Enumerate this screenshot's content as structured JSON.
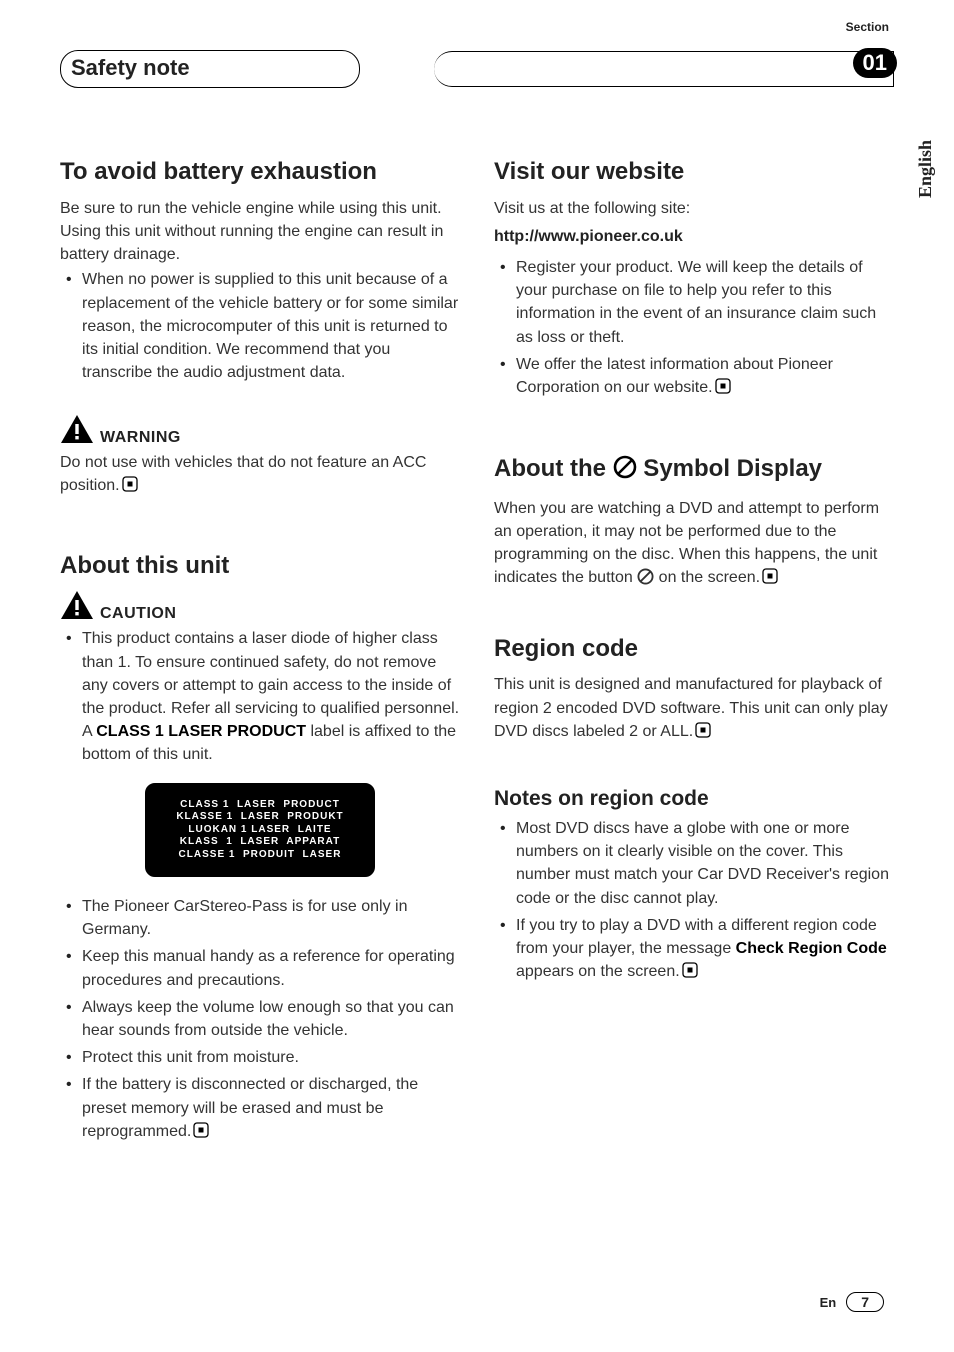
{
  "header": {
    "safety_title": "Safety note",
    "section_label": "Section",
    "section_number": "01",
    "language_tab": "English"
  },
  "left": {
    "h_battery": "To avoid battery exhaustion",
    "p_battery": "Be sure to run the vehicle engine while using this unit. Using this unit without running the engine can result in battery drainage.",
    "li_battery": "When no power is supplied to this unit because of a replacement of the vehicle battery or for some similar reason, the microcomputer of this unit is returned to its initial condition. We recommend that you transcribe the audio adjustment data.",
    "warning_label": "WARNING",
    "p_warning": "Do not use with vehicles that do not feature an ACC position.",
    "h_about": "About this unit",
    "caution_label": "CAUTION",
    "li_caution1_a": "This product contains a laser diode of higher class than 1. To ensure continued safety, do not remove any covers or attempt to gain access to the inside of the product. Refer all servicing to qualified personnel.",
    "li_caution1_b_pre": "A ",
    "li_caution1_b_bold": "CLASS 1 LASER PRODUCT",
    "li_caution1_b_post": " label is affixed to the bottom of this unit.",
    "laser_lines": {
      "l1": "CLASS 1  LASER  PRODUCT",
      "l2": "KLASSE 1  LASER  PRODUKT",
      "l3": "LUOKAN 1 LASER  LAITE",
      "l4": "KLASS  1  LASER  APPARAT",
      "l5": "CLASSE 1  PRODUIT  LASER"
    },
    "li_g1": "The Pioneer CarStereo-Pass is for use only in Germany.",
    "li_g2": "Keep this manual handy as a reference for operating procedures and precautions.",
    "li_g3": "Always keep the volume low enough so that you can hear sounds from outside the vehicle.",
    "li_g4": "Protect this unit from moisture.",
    "li_g5": "If the battery is disconnected or discharged, the preset memory will be erased and must be reprogrammed."
  },
  "right": {
    "h_visit": "Visit our website",
    "p_visit": "Visit us at the following site:",
    "url": "http://www.pioneer.co.uk",
    "li_v1": "Register your product. We will keep the details of your purchase on file to help you refer to this information in the event of an insurance claim such as loss or theft.",
    "li_v2": "We offer the latest information about Pioneer Corporation on our website.",
    "h_symbol_pre": "About the ",
    "h_symbol_post": " Symbol Display",
    "p_symbol_a": "When you are watching a DVD and attempt to perform an operation, it may not be performed due to the programming on the disc. When this happens, the unit indicates the button ",
    "p_symbol_b": " on the screen.",
    "h_region": "Region code",
    "p_region": "This unit is designed and manufactured for playback of region 2 encoded DVD software. This unit can only play DVD discs labeled 2 or ALL.",
    "h_notes": "Notes on region code",
    "li_n1": "Most DVD discs have a globe with one or more numbers on it clearly visible on the cover. This number must match your Car DVD Receiver's region code or the disc cannot play.",
    "li_n2_a": "If you try to play a DVD with a different region code from your player, the message ",
    "li_n2_bold": "Check Region Code",
    "li_n2_b": " appears on the screen."
  },
  "footer": {
    "lang": "En",
    "page": "7"
  }
}
